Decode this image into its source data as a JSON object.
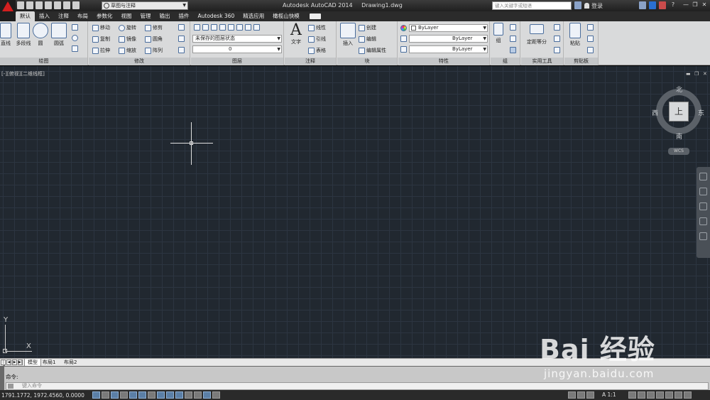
{
  "title_bar": {
    "app_name": "Autodesk AutoCAD 2014",
    "document": "Drawing1.dwg",
    "workspace": "草图与注释",
    "search_placeholder": "键入关键字或短语",
    "login_label": "登录",
    "help_label": "?"
  },
  "tabs": [
    "默认",
    "插入",
    "注释",
    "布局",
    "参数化",
    "视图",
    "管理",
    "输出",
    "插件",
    "Autodesk 360",
    "精选应用",
    "橄榄山快模"
  ],
  "ribbon": {
    "draw": {
      "title": "绘图",
      "line": "直线",
      "polyline": "多段线",
      "circle": "圆",
      "arc": "圆弧"
    },
    "modify": {
      "title": "修改",
      "move": "移动",
      "rotate": "旋转",
      "trim": "修剪",
      "copy": "复制",
      "mirror": "镜像",
      "fillet": "圆角",
      "stretch": "拉伸",
      "scale": "缩放",
      "array": "阵列"
    },
    "layers": {
      "title": "图层",
      "layer_state": "未保存的图层状态",
      "current_layer": "0"
    },
    "annotation": {
      "title": "注释",
      "text": "文字",
      "linear": "线性",
      "leader": "引线",
      "table": "表格"
    },
    "block": {
      "title": "块",
      "insert": "插入",
      "create": "创建",
      "edit": "编辑",
      "edit_attributes": "编辑属性"
    },
    "properties": {
      "title": "特性",
      "color": "ByLayer",
      "linetype": "ByLayer",
      "lineweight": "ByLayer"
    },
    "groups": {
      "title": "组",
      "group": "组"
    },
    "utilities": {
      "title": "实用工具",
      "measure": "定距等分"
    },
    "clipboard": {
      "title": "剪贴板",
      "paste": "粘贴"
    }
  },
  "viewport": {
    "label": "[-][俯视][二维线框]",
    "viewcube": {
      "north": "北",
      "south": "南",
      "west": "西",
      "east": "东",
      "face": "上"
    },
    "wcs": "WCS",
    "ucs_x": "X",
    "ucs_y": "Y"
  },
  "layout_tabs": [
    "模型",
    "布局1",
    "布局2"
  ],
  "command": {
    "history": "命令:",
    "placeholder": "键入命令"
  },
  "status": {
    "coordinates": "1791.1772, 1972.4560, 0.0000",
    "annotation_scale": "A 1:1"
  },
  "watermark": {
    "logo": "Bai 经验",
    "url": "jingyan.baidu.com"
  }
}
